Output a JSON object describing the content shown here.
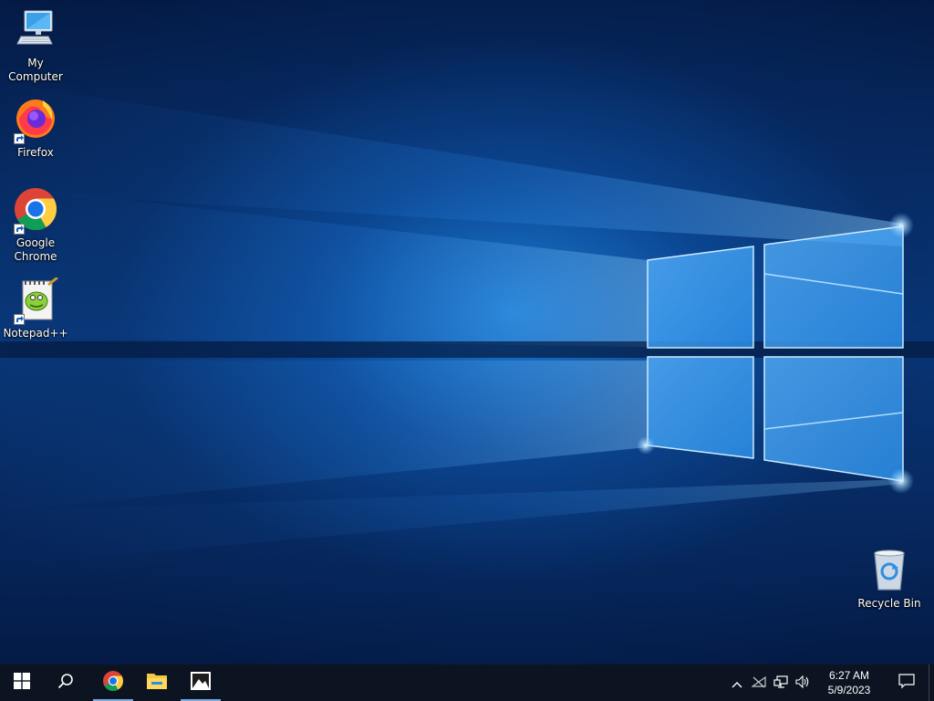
{
  "desktop_icons": {
    "my_computer": "My Computer",
    "firefox": "Firefox",
    "chrome": "Google Chrome",
    "notepadpp": "Notepad++",
    "recycle_bin": "Recycle Bin"
  },
  "taskbar": {
    "start_icon": "windows-logo-icon",
    "search_icon": "search-icon",
    "pinned": [
      "chrome-icon",
      "file-explorer-icon",
      "photos-icon"
    ]
  },
  "tray": {
    "icons": [
      "chevron-up-icon",
      "network-disconnected-icon",
      "ethernet-icon",
      "volume-icon"
    ],
    "time": "6:27 AM",
    "date": "5/9/2023"
  },
  "colors": {
    "taskbar": "#0b1420",
    "wallpaper_accent": "#1c80da",
    "active_indicator": "#7aa9e0"
  }
}
